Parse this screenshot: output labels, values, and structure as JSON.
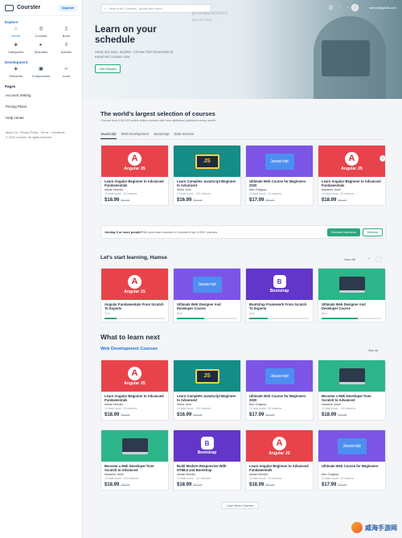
{
  "app": {
    "name": "Courster",
    "upgrade": "Upgrade"
  },
  "sidebar": {
    "explore_label": "Explore",
    "items": [
      {
        "label": "Home",
        "icon": "home-icon"
      },
      {
        "label": "Courses",
        "icon": "courses-icon"
      },
      {
        "label": "Book",
        "icon": "book-icon"
      },
      {
        "label": "Categories",
        "icon": "layers-icon"
      },
      {
        "label": "Episodes",
        "icon": "play-icon"
      },
      {
        "label": "Articles",
        "icon": "article-icon"
      }
    ],
    "develop_label": "Development",
    "dev_items": [
      {
        "label": "Elements",
        "icon": "layers-icon"
      },
      {
        "label": "Components",
        "icon": "components-icon"
      },
      {
        "label": "Icons",
        "icon": "code-icon"
      }
    ],
    "pages_label": "Pages",
    "pages": [
      "Account Setting",
      "Pricing Plans",
      "Help center"
    ],
    "footer_links": "About Us · Privacy Policy · Terms · Conditions",
    "copyright": "© 2020 Courster. All rights reserved."
  },
  "header": {
    "search_placeholder": "Search for Courses , books and more.",
    "watermark1": "pcocutanamunci",
    "watermark2": "pocolorzane",
    "email": "hamse@gmail.com"
  },
  "hero": {
    "title_line1": "Learn on your",
    "title_line2": "schedule",
    "subtitle": "Study any topic, anytime. Choose from thousands of expert-led courses now.",
    "cta": "Get Started"
  },
  "selection": {
    "title": "The world's largest selection of courses",
    "subtitle": "Choose from 130,000 online video courses with new additions published every month",
    "tabs": [
      "JavaScript",
      "Web Development",
      "JavaScript",
      "Data Science"
    ]
  },
  "cards_row1": [
    {
      "thumb": "angular",
      "mark": "Angular JS",
      "title": "Learn Angular Beginner to Advanced Fundamentals",
      "author": "Adrian Mohani",
      "meta": "13 total hours · 32 lectures",
      "price": "$18.99",
      "old": "$32.00"
    },
    {
      "thumb": "js",
      "mark": "JS",
      "title": "Learn Complete JavaScript Beginner to Advanced",
      "author": "Stella John",
      "meta": "13 total hours · 122 lectures",
      "price": "$16.99",
      "old": "$32.00"
    },
    {
      "thumb": "jsb",
      "mark": "Javascript",
      "title": "Ultimate Web Course for Beginners 2020",
      "author": "Alex Dolgava",
      "meta": "13 total hours · 32 lectures",
      "price": "$17.99",
      "old": "$32.00"
    },
    {
      "thumb": "angular",
      "mark": "Angular JS",
      "title": "Learn Angular Beginner to Advanced Fundamentals",
      "author": "Madame Josef",
      "meta": "13 total hours · 32 lectures",
      "price": "$18.99",
      "old": "$32.00"
    }
  ],
  "banner": {
    "bold": "Joining 5 or more people?",
    "text": " Get your team access to Courster's top 4,000+ courses",
    "btn1": "Become Instructor",
    "btn2": "Dismiss"
  },
  "learning": {
    "title": "Let's start learning, Hamse",
    "view_all": "View All",
    "cards": [
      {
        "thumb": "angular",
        "mark": "Angular JS",
        "title": "Angular Fundamentals From Scratch To Experts",
        "progress": 0.2,
        "progress_text": "7/15"
      },
      {
        "thumb": "jsb",
        "mark": "Javascript",
        "title": "Ultimate Web Designer And Developer Course",
        "progress": 0.45,
        "progress_text": "6/12"
      },
      {
        "thumb": "bs",
        "mark": "Bootstrap",
        "title": "Bootstrap Framework From Scratch To Experts",
        "progress": 0.3,
        "progress_text": "4/12"
      },
      {
        "thumb": "web",
        "mark": "",
        "title": "Ultimate Web Designer And Developer Course",
        "progress": 0.6,
        "progress_text": "6/10"
      }
    ]
  },
  "whatto": {
    "title": "What to learn next",
    "subtitle": "Web Development Courses",
    "see_all": "See all",
    "row1": [
      {
        "thumb": "angular",
        "mark": "Angular JS",
        "title": "Learn Angular Beginner to Advanced Fundamentals",
        "author": "Adrian Mohani",
        "meta": "13 total hours · 32 lectures",
        "price": "$18.99",
        "old": "$32.00"
      },
      {
        "thumb": "js",
        "mark": "JS",
        "title": "Learn Complete JavaScript Beginner to Advanced",
        "author": "Stella John",
        "meta": "13 total hours · 122 lectures",
        "price": "$16.99",
        "old": "$32.00"
      },
      {
        "thumb": "jsb",
        "mark": "Javascript",
        "title": "Ultimate Web Course for Beginners 2020",
        "author": "Alex Dolgava",
        "meta": "13 total hours · 32 lectures",
        "price": "$17.99",
        "old": "$32.00"
      },
      {
        "thumb": "web",
        "mark": "",
        "title": "Become a Web Developer from Scratch to Advanced",
        "author": "Madame Josef",
        "meta": "13 total hours · 122 lectures",
        "price": "$18.99",
        "old": "$32.00"
      }
    ],
    "row2": [
      {
        "thumb": "web",
        "mark": "",
        "title": "Become a Web Developer from Scratch to Advanced",
        "author": "Madame Josef",
        "meta": "13 total hours · 122 lectures",
        "price": "$18.99",
        "old": "$32.00"
      },
      {
        "thumb": "bs",
        "mark": "Bootstrap",
        "title": "Build Modern Responsive With HTML5 and Bootstrap",
        "author": "Adrian Mohani",
        "meta": "13 total hours · 117 lectures",
        "price": "$18.99",
        "old": "$32.00"
      },
      {
        "thumb": "angular",
        "mark": "Angular JS",
        "title": "Learn Angular Beginner to Advanced Fundamentals",
        "author": "Adrian Mohani",
        "meta": "13 total hours · 32 lectures",
        "price": "$18.99",
        "old": "$32.00"
      },
      {
        "thumb": "jsb",
        "mark": "Javascript",
        "title": "Ultimate Web Course for Beginners",
        "author": "Alex Dolgava",
        "meta": "13 total hours · 32 lectures",
        "price": "$17.99",
        "old": "$32.00"
      }
    ],
    "load_more": "Load More Courses"
  },
  "watermark": {
    "text": "威海手游网"
  },
  "colors": {
    "accent": "#1f6fd6",
    "green": "#2aa87e",
    "angular": "#e8434b",
    "js": "#158c86",
    "purple": "#7c55e6"
  }
}
